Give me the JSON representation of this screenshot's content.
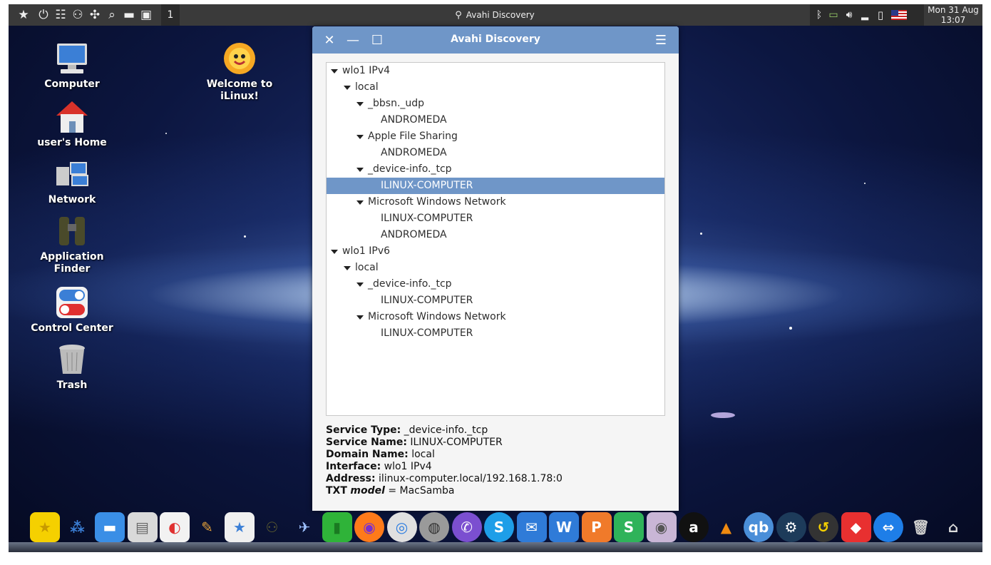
{
  "top_panel": {
    "workspace": "1",
    "task_title": "Avahi Discovery",
    "clock": {
      "day": "Mon 31 Aug",
      "time": "13:07"
    }
  },
  "desktop": {
    "icons": [
      {
        "label_line1": "Computer",
        "label_line2": ""
      },
      {
        "label_line1": "user's Home",
        "label_line2": ""
      },
      {
        "label_line1": "Network",
        "label_line2": ""
      },
      {
        "label_line1": "Application",
        "label_line2": "Finder"
      },
      {
        "label_line1": "Control Center",
        "label_line2": ""
      },
      {
        "label_line1": "Trash",
        "label_line2": ""
      },
      {
        "label_line1": "Welcome to",
        "label_line2": "iLinux!"
      }
    ]
  },
  "window": {
    "title": "Avahi Discovery",
    "tree": [
      {
        "text": "wlo1 IPv4",
        "level": 0,
        "expander": true,
        "selected": false
      },
      {
        "text": "local",
        "level": 1,
        "expander": true,
        "selected": false
      },
      {
        "text": "_bbsn._udp",
        "level": 2,
        "expander": true,
        "selected": false
      },
      {
        "text": "ANDROMEDA",
        "level": 3,
        "expander": false,
        "selected": false
      },
      {
        "text": "Apple File Sharing",
        "level": 2,
        "expander": true,
        "selected": false
      },
      {
        "text": "ANDROMEDA",
        "level": 3,
        "expander": false,
        "selected": false
      },
      {
        "text": "_device-info._tcp",
        "level": 2,
        "expander": true,
        "selected": false
      },
      {
        "text": "ILINUX-COMPUTER",
        "level": 3,
        "expander": false,
        "selected": true
      },
      {
        "text": "Microsoft Windows Network",
        "level": 2,
        "expander": true,
        "selected": false
      },
      {
        "text": "ILINUX-COMPUTER",
        "level": 3,
        "expander": false,
        "selected": false
      },
      {
        "text": "ANDROMEDA",
        "level": 3,
        "expander": false,
        "selected": false
      },
      {
        "text": "wlo1 IPv6",
        "level": 0,
        "expander": true,
        "selected": false
      },
      {
        "text": "local",
        "level": 1,
        "expander": true,
        "selected": false
      },
      {
        "text": "_device-info._tcp",
        "level": 2,
        "expander": true,
        "selected": false
      },
      {
        "text": "ILINUX-COMPUTER",
        "level": 3,
        "expander": false,
        "selected": false
      },
      {
        "text": "Microsoft Windows Network",
        "level": 2,
        "expander": true,
        "selected": false
      },
      {
        "text": "ILINUX-COMPUTER",
        "level": 3,
        "expander": false,
        "selected": false
      }
    ],
    "details": {
      "service_type_label": "Service Type:",
      "service_type": "_device-info._tcp",
      "service_name_label": "Service Name:",
      "service_name": "ILINUX-COMPUTER",
      "domain_name_label": "Domain Name:",
      "domain_name": "local",
      "interface_label": "Interface:",
      "interface": "wlo1 IPv4",
      "address_label": "Address:",
      "address": "ilinux-computer.local/192.168.1.78:0",
      "txt_label": "TXT",
      "txt_key": "model",
      "txt_value": "= MacSamba"
    }
  },
  "dock": {
    "items": [
      "favorites-star-icon",
      "app-grid-icon",
      "desktop-icon",
      "file-cabinet-icon",
      "control-center-icon",
      "color-palette-icon",
      "store-icon",
      "binoculars-icon",
      "rocket-icon",
      "green-pipe-icon",
      "firefox-icon",
      "chrome-icon",
      "globe-pro-icon",
      "viber-icon",
      "skype-icon",
      "mail-icon",
      "writer-icon",
      "presentation-icon",
      "spreadsheet-icon",
      "webcam-icon",
      "a-icon",
      "vlc-icon",
      "qbittorrent-icon",
      "steam-icon",
      "timeshift-icon",
      "anydesk-icon",
      "teamviewer-icon",
      "trash-icon",
      "hanger-icon"
    ]
  }
}
